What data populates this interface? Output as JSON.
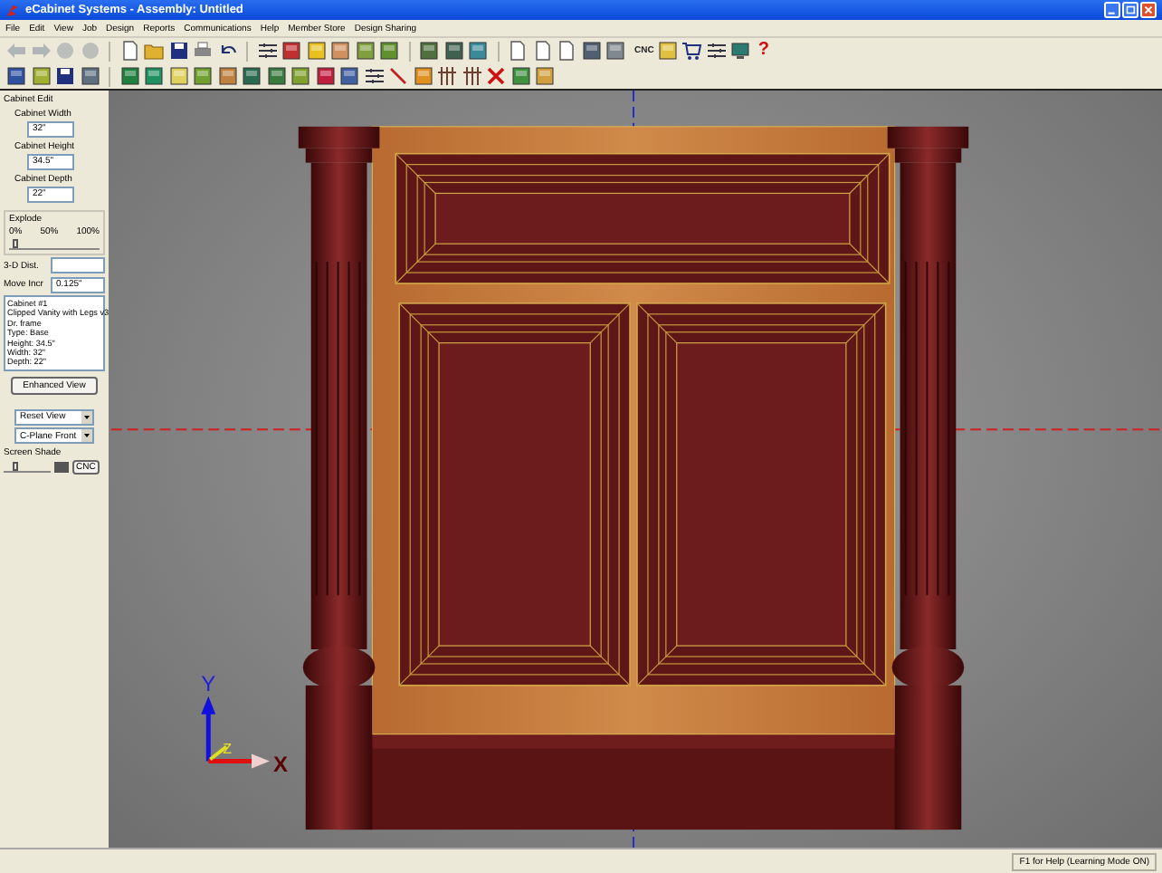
{
  "window": {
    "title": "eCabinet Systems - Assembly: Untitled"
  },
  "menu": [
    "File",
    "Edit",
    "View",
    "Job",
    "Design",
    "Reports",
    "Communications",
    "Help",
    "Member Store",
    "Design Sharing"
  ],
  "toolbar": {
    "cnc_label": "CNC",
    "help_label": "?"
  },
  "panel": {
    "title": "Cabinet Edit",
    "fields": [
      {
        "label": "Cabinet Width",
        "value": "32\""
      },
      {
        "label": "Cabinet Height",
        "value": "34.5\""
      },
      {
        "label": "Cabinet Depth",
        "value": "22\""
      }
    ],
    "explode": {
      "label": "Explode",
      "ticks": [
        "0%",
        "50%",
        "100%"
      ],
      "level": 0.03
    },
    "dist": {
      "label": "3-D Dist."
    },
    "move_incr": {
      "label": "Move Incr",
      "value": "0.125\""
    },
    "info": [
      "Cabinet #1",
      "Clipped Vanity with Legs v3",
      "Dr. frame",
      "Type: Base",
      "Height: 34.5\"",
      "Width: 32\"",
      "Depth: 22\""
    ],
    "enhanced_button": "Enhanced View",
    "view_select": "Reset View",
    "plane_select": "C-Plane Front",
    "shade": {
      "label": "Screen Shade",
      "level": 0.2
    },
    "cnc_button": "CNC"
  },
  "viewport": {
    "axes": [
      "Y",
      "Z",
      "X"
    ]
  },
  "status_bar": "F1 for Help (Learning Mode ON)"
}
